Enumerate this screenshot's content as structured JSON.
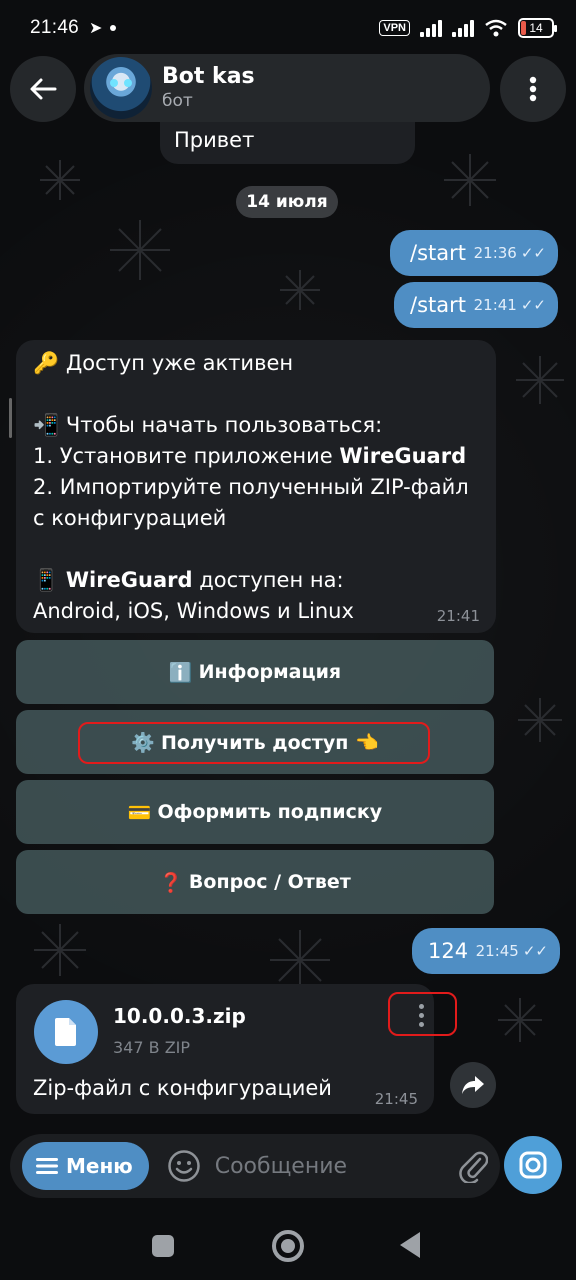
{
  "status_bar": {
    "time": "21:46",
    "vpn": "VPN",
    "battery": "14"
  },
  "header": {
    "chat_name": "Bot kas",
    "chat_subtitle": "бот"
  },
  "messages": {
    "prev_incoming": "Привет",
    "date_chip": "14 июля",
    "out1": {
      "text": "/start",
      "time": "21:36"
    },
    "out2": {
      "text": "/start",
      "time": "21:41"
    },
    "bot_reply": {
      "line1_emoji": "🔑",
      "line1": "Доступ уже активен",
      "line2_emoji": "📲",
      "line2": "Чтобы начать пользоваться:",
      "line3_a": "1. Установите приложение ",
      "line3_b": "WireGuard",
      "line4": "2. Импортируйте полученный ZIP-файл",
      "line5": "с конфигурацией",
      "line6_emoji": "📱",
      "line6_b": "WireGuard",
      "line6_a": " доступен на:",
      "line7": "Android, iOS, Windows и Linux",
      "time": "21:41"
    },
    "keyboard": [
      {
        "emoji": "ℹ️",
        "label": "Информация"
      },
      {
        "emoji": "⚙️",
        "label": "Получить доступ 👈"
      },
      {
        "emoji": "💳",
        "label": "Оформить подписку"
      },
      {
        "emoji": "❓",
        "label": "Вопрос / Ответ"
      }
    ],
    "out3": {
      "text": "124",
      "time": "21:45"
    },
    "file": {
      "name": "10.0.0.3.zip",
      "size": "347 B ZIP",
      "caption": "Zip-файл с конфигурацией",
      "time": "21:45"
    }
  },
  "input": {
    "menu_label": "Меню",
    "placeholder": "Сообщение"
  },
  "colors": {
    "accent": "#4f8ec4",
    "keyboard_button": "#485e60",
    "highlight": "#e21b1b"
  }
}
